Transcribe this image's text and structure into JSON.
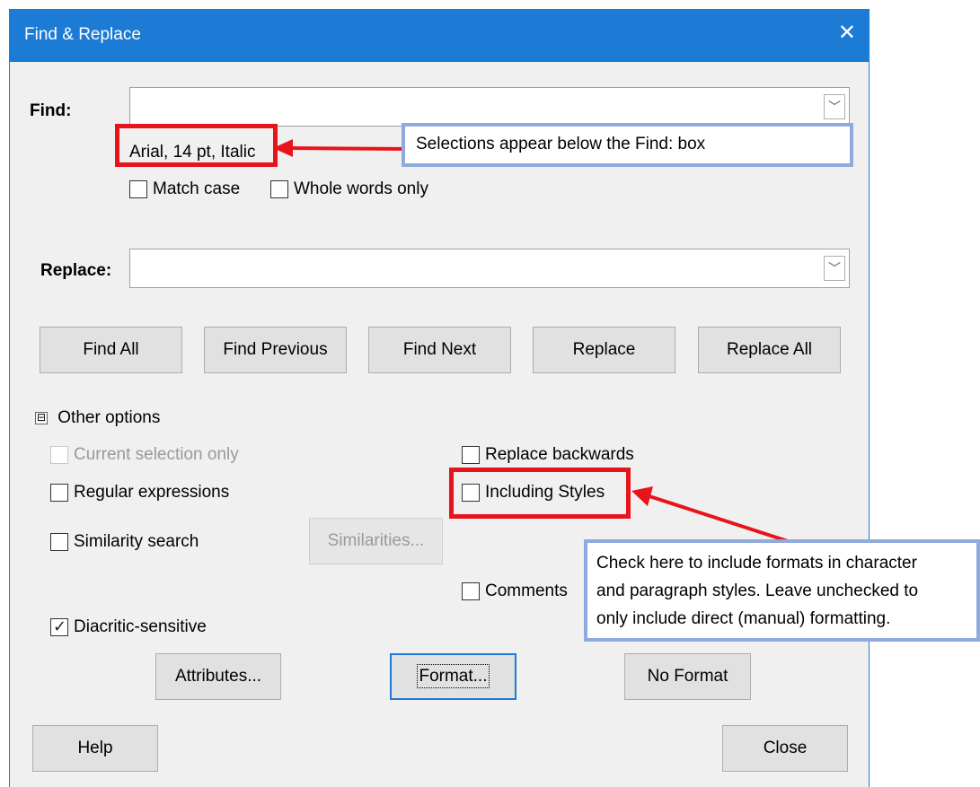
{
  "dialog": {
    "title": "Find & Replace",
    "close_glyph": "✕"
  },
  "find": {
    "label": "Find:",
    "value": "",
    "selected_format": "Arial, 14 pt, Italic",
    "match_case": "Match case",
    "whole_words": "Whole words only"
  },
  "replace": {
    "label": "Replace:",
    "value": ""
  },
  "buttons": {
    "find_all": "Find All",
    "find_previous": "Find Previous",
    "find_next": "Find Next",
    "replace": "Replace",
    "replace_all": "Replace All"
  },
  "other_options": {
    "toggle_glyph": "⊟",
    "label": "Other options",
    "current_selection_only": "Current selection only",
    "regular_expressions": "Regular expressions",
    "similarity_search": "Similarity search",
    "similarities_button": "Similarities...",
    "diacritic_sensitive": "Diacritic-sensitive",
    "replace_backwards": "Replace backwards",
    "including_styles": "Including Styles",
    "comments": "Comments"
  },
  "format_buttons": {
    "attributes": "Attributes...",
    "format": "Format...",
    "no_format": "No Format"
  },
  "footer": {
    "help": "Help",
    "close": "Close"
  },
  "annotations": {
    "callout_find": "Selections appear below the Find: box",
    "callout_styles_lines": [
      "Check here to include formats in character",
      "and paragraph styles.  Leave unchecked to",
      "only include direct (manual) formatting."
    ],
    "colors": {
      "red": "#e8141b",
      "callout_border": "#8faadc",
      "titlebar": "#1b7bd5"
    }
  }
}
